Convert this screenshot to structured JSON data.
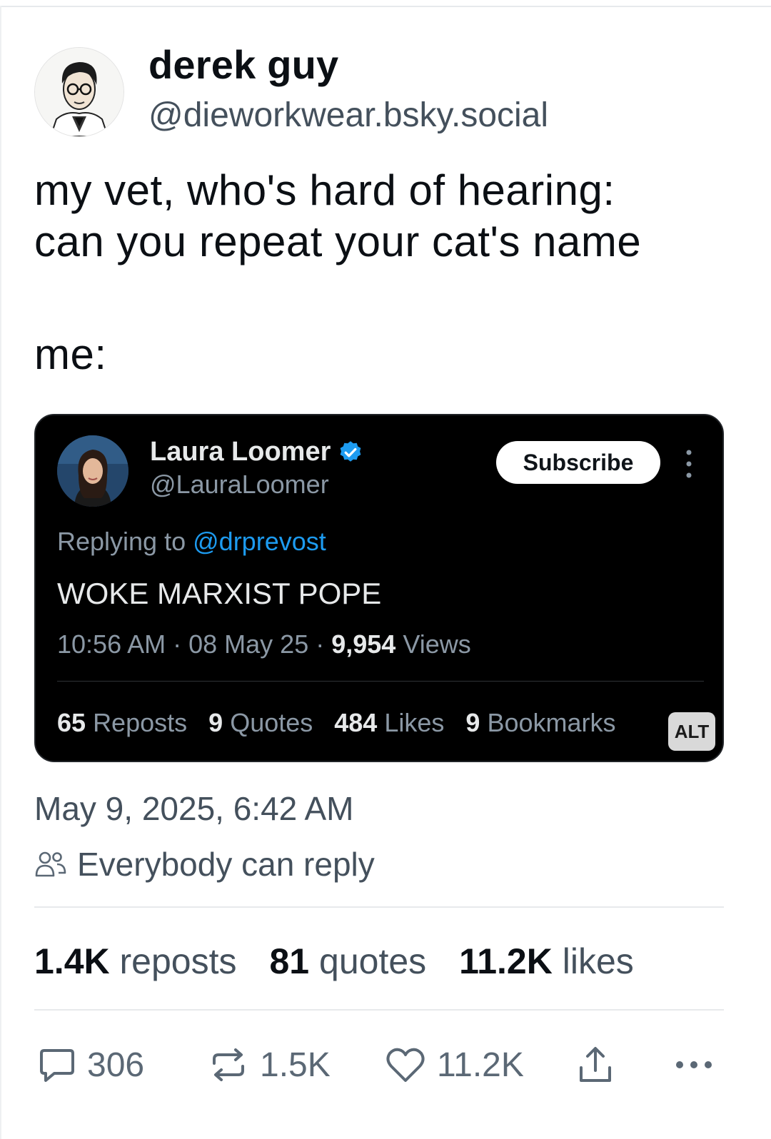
{
  "author": {
    "name": "derek guy",
    "handle": "@dieworkwear.bsky.social",
    "avatar_icon": "illustrated-portrait-avatar"
  },
  "post": {
    "lines": [
      "my vet, who's hard of hearing:",
      "can you repeat your cat's name",
      "me:"
    ]
  },
  "embed": {
    "name": "Laura Loomer",
    "handle": "@LauraLoomer",
    "verified_icon": "verified-badge-icon",
    "subscribe_label": "Subscribe",
    "replying_prefix": "Replying to",
    "replying_to": "@drprevost",
    "text": "WOKE MARXIST POPE",
    "meta_time": "10:56 AM",
    "meta_date": "08 May 25",
    "meta_views_count": "9,954",
    "meta_views_label": "Views",
    "stats": [
      {
        "count": "65",
        "label": "Reposts"
      },
      {
        "count": "9",
        "label": "Quotes"
      },
      {
        "count": "484",
        "label": "Likes"
      },
      {
        "count": "9",
        "label": "Bookmarks"
      }
    ],
    "alt_label": "ALT"
  },
  "timestamp": "May 9, 2025, 6:42 AM",
  "reply_setting": "Everybody can reply",
  "stats": [
    {
      "count": "1.4K",
      "label": "reposts"
    },
    {
      "count": "81",
      "label": "quotes"
    },
    {
      "count": "11.2K",
      "label": "likes"
    }
  ],
  "actions": {
    "reply_count": "306",
    "repost_count": "1.5K",
    "like_count": "11.2K"
  },
  "colors": {
    "text_primary": "#0b0f14",
    "text_secondary": "#44505c",
    "embed_bg": "#000000",
    "mention_blue": "#1d9bf0"
  }
}
